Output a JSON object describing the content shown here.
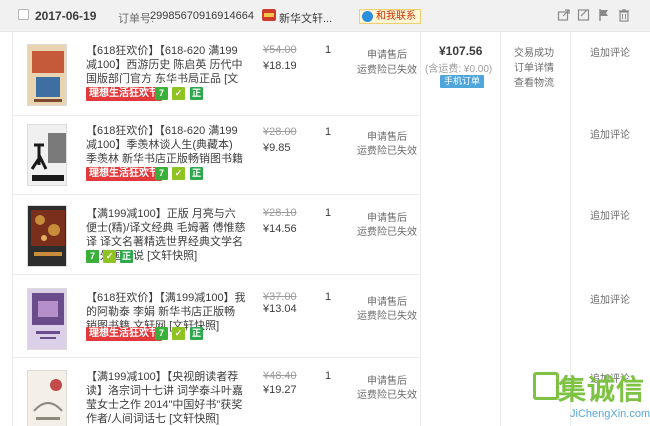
{
  "order": {
    "date": "2017-06-19",
    "number_label": "订单号:",
    "number": "29985670916914664",
    "shop_name": "新华文轩...",
    "contact_label": "和我联系",
    "total": "¥107.56",
    "shipping": "(含运费: ¥0.00)",
    "pay_label": "手机订单",
    "status_lines": [
      "交易成功",
      "订单详情",
      "查看物流"
    ],
    "header_icons": [
      "share-icon",
      "edit-icon",
      "flag-icon",
      "trash-icon"
    ]
  },
  "items": [
    {
      "title": "【618狂欢价】【618-620 满199减100】西游历史 陈启英 历代中国版部门官方 东华书局正品 [文轩网]",
      "fest_label": "理想生活狂欢节",
      "orig_price": "¥54.00",
      "price": "¥18.19",
      "qty": "1",
      "action1": "申请售后",
      "action2": "运费险已失效",
      "review": "追加评论",
      "cover_colors": [
        "#c45a3a",
        "#3d6fa3",
        "#e8d4b0"
      ]
    },
    {
      "title": "【618狂欢价】【618-620 满199减100】季羡林谈人生(典藏本) 季羡林 新华书店正版畅销图书籍 文轩 [文轩快照]",
      "fest_label": "理想生活狂欢节",
      "orig_price": "¥28.00",
      "price": "¥9.85",
      "qty": "1",
      "action1": "申请售后",
      "action2": "运费险已失效",
      "review": "追加评论",
      "cover_colors": [
        "#1a1a1a",
        "#7a7a7a",
        "#f0f0f0"
      ]
    },
    {
      "title": "【满199减100】正版 月亮与六便士(精)/译文经典 毛姆著 傅惟慈译 译文名著精选世界经典文学名著 外国小说 [文轩快照]",
      "orig_price": "¥28.10",
      "price": "¥14.56",
      "qty": "1",
      "action1": "申请售后",
      "action2": "运费险已失效",
      "review": "追加评论",
      "cover_colors": [
        "#7a2f1c",
        "#c98c3b",
        "#2d2d2d"
      ]
    },
    {
      "title": "【618狂欢价】【满199减100】我的阿勒泰 李娟 新华书店正版畅销图书籍 文轩网 [文轩快照]",
      "fest_label": "理想生活狂欢节",
      "orig_price": "¥37.00",
      "price": "¥13.04",
      "qty": "1",
      "action1": "申请售后",
      "action2": "运费险已失效",
      "review": "追加评论",
      "cover_colors": [
        "#6b4c8a",
        "#b58fc9",
        "#dcd0e8"
      ]
    },
    {
      "title": "【满199减100】【央视朗读者荐读】洛宗词十七讲 词学泰斗叶嘉莹女士之作 2014\"中国好书\"获奖作者/人间词话七 [文轩快照]",
      "orig_price": "¥48.40",
      "price": "¥19.27",
      "qty": "1",
      "action1": "申请售后",
      "action2": "运费险已失效",
      "review": "追加评论",
      "cover_colors": [
        "#f4f0e8",
        "#c24a4a",
        "#8a8a7a"
      ]
    }
  ],
  "watermark": {
    "text": "集诚信",
    "url": "JiChengXin.com"
  }
}
